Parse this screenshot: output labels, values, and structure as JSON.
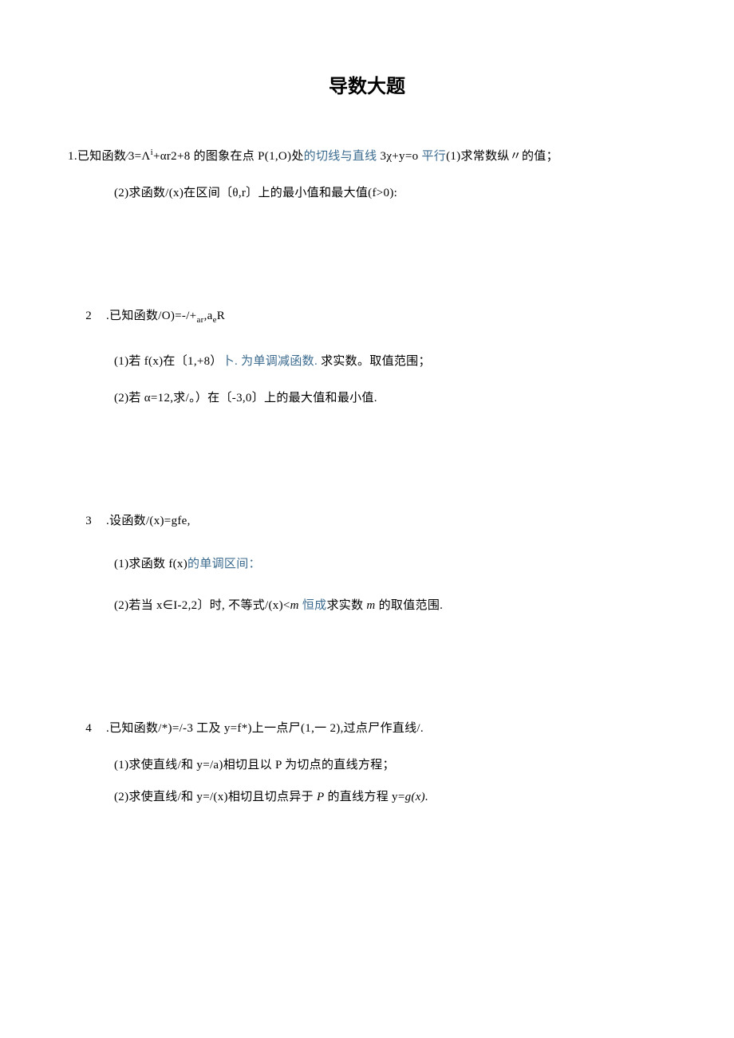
{
  "title": "导数大题",
  "problems": [
    {
      "num": "1",
      "line1_a": ".已知函数⁄3=Λ",
      "line1_b": "+αr2+8 的图象在点 P(1,O)处",
      "line1_hl1": "的切线与直线",
      "line1_c": " 3χ+y=o ",
      "line1_hl2": "平行",
      "line1_d": "(1)求常数纵〃的值；",
      "sub2": "(2)求函数/(x)在区间〔θ,r〕上的最小值和最大值(f>0):"
    },
    {
      "num": "2",
      "line1": ".已知函数/O)=-/+",
      "line1_sub": "ar",
      "line1_after": ",a",
      "line1_sub2": "e",
      "line1_end": "R",
      "sub1_a": "(1)若 f(x)在〔1,+8）",
      "sub1_hl": "卜. 为单调减函数.",
      "sub1_b": " 求实数。取值范围；",
      "sub2": "(2)若 α=12,求/。）在〔-3,0〕上的最大值和最小值."
    },
    {
      "num": "3",
      "line1": ".设函数/(x)=gfe,",
      "sub1_a": "(1)求函数 f(x)",
      "sub1_hl": "的单调区间：",
      "sub2_a": "(2)若当 x∈I-2,2〕时, 不等式/(x)<",
      "sub2_m": "m ",
      "sub2_hl": "恒成",
      "sub2_b": "求实数 ",
      "sub2_m2": "m",
      "sub2_c": " 的取值范围."
    },
    {
      "num": "4",
      "line1": ".已知函数/*)=/-3 工及 y=f*)上一点尸(1,一 2),过点尸作直线/.",
      "sub1": "(1)求使直线/和 y=/a)相切且以 P 为切点的直线方程；",
      "sub2_a": "(2)求使直线/和 y=/(x)相切且切点异于 ",
      "sub2_p": "P",
      "sub2_b": " 的直线方程 y=",
      "sub2_g": "g(x).",
      "sub2_end": ""
    }
  ]
}
